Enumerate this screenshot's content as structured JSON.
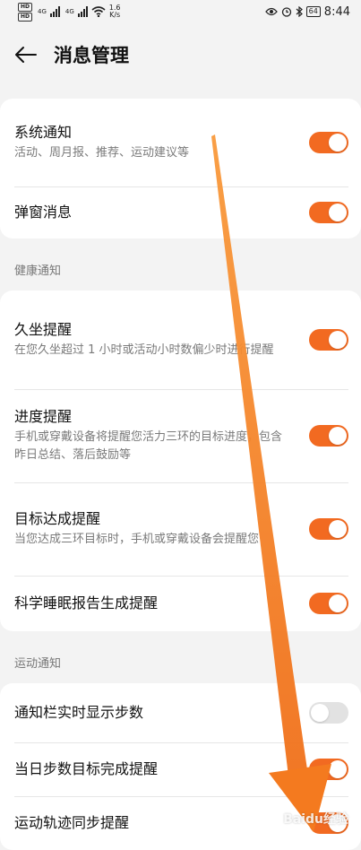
{
  "status_bar": {
    "hd1": "HD",
    "hd2": "HD",
    "net1": "4G",
    "net2": "4G",
    "speed_value": "1.6",
    "speed_unit": "K/s",
    "battery": "64",
    "time": "8:44"
  },
  "header": {
    "title": "消息管理"
  },
  "groups": [
    {
      "label": "",
      "items": [
        {
          "title": "系统通知",
          "subtitle": "活动、周月报、推荐、运动建议等",
          "on": true
        },
        {
          "title": "弹窗消息",
          "subtitle": "",
          "on": true
        }
      ]
    },
    {
      "label": "健康通知",
      "items": [
        {
          "title": "久坐提醒",
          "subtitle": "在您久坐超过 1 小时或活动小时数偏少时进行提醒",
          "on": true
        },
        {
          "title": "进度提醒",
          "subtitle": "手机或穿戴设备将提醒您活力三环的目标进度，包含昨日总结、落后鼓励等",
          "on": true
        },
        {
          "title": "目标达成提醒",
          "subtitle": "当您达成三环目标时，手机或穿戴设备会提醒您",
          "on": true
        },
        {
          "title": "科学睡眠报告生成提醒",
          "subtitle": "",
          "on": true
        }
      ]
    },
    {
      "label": "运动通知",
      "items": [
        {
          "title": "通知栏实时显示步数",
          "subtitle": "",
          "on": false
        },
        {
          "title": "当日步数目标完成提醒",
          "subtitle": "",
          "on": true
        },
        {
          "title": "运动轨迹同步提醒",
          "subtitle": "",
          "on": true
        }
      ]
    }
  ],
  "colors": {
    "accent": "#f26a21",
    "toggle_off": "#e2e2e2",
    "background": "#f3f3f3",
    "arrow": "#f47a1f"
  },
  "icons": {
    "back": "arrow-left-icon",
    "alarm": "alarm-icon",
    "eye": "eye-icon",
    "bluetooth": "bluetooth-icon",
    "wifi": "wifi-icon"
  },
  "watermark": "Baidu经验"
}
